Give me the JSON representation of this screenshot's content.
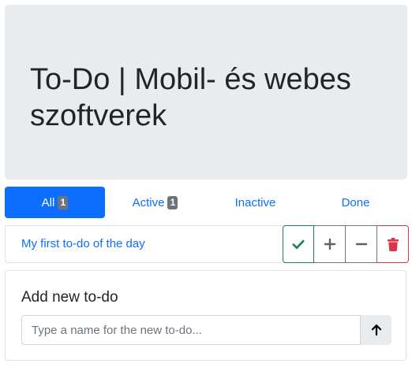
{
  "header": {
    "title": "To-Do | Mobil- és webes szoftverek"
  },
  "tabs": [
    {
      "label": "All",
      "badge": "1",
      "active": true
    },
    {
      "label": "Active",
      "badge": "1",
      "active": false
    },
    {
      "label": "Inactive",
      "badge": "",
      "active": false
    },
    {
      "label": "Done",
      "badge": "",
      "active": false
    }
  ],
  "todos": [
    {
      "name": "My first to-do of the day",
      "actions": [
        "check-icon",
        "plus-icon",
        "minus-icon",
        "trash-icon"
      ]
    }
  ],
  "new_todo": {
    "heading": "Add new to-do",
    "placeholder": "Type a name for the new to-do...",
    "value": "",
    "submit_icon": "arrow-up-icon"
  },
  "colors": {
    "primary": "#0d6efd",
    "success": "#198754",
    "secondary": "#6c757d",
    "danger": "#dc3545",
    "jumbotron_bg": "#e9ecef"
  }
}
